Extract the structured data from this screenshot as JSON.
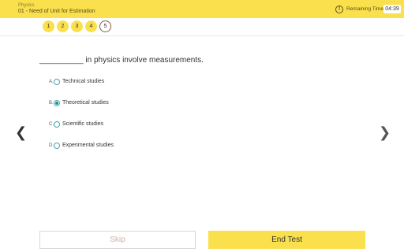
{
  "header": {
    "subject": "Physics",
    "topic": "01 - Need of Unit for Estimation",
    "timer_icon": "info-icon",
    "timer_label": "Remaining Time:",
    "timer_value": "04:39"
  },
  "question_nav": [
    "1",
    "2",
    "3",
    "4",
    "5"
  ],
  "question": {
    "text": "__________ in physics involve measurements.",
    "options": [
      {
        "letter": "A.",
        "text": "Technical studies"
      },
      {
        "letter": "B.",
        "text": "Theoretical studies"
      },
      {
        "letter": "C.",
        "text": "Scientific studies"
      },
      {
        "letter": "D.",
        "text": "Experimental studies"
      }
    ],
    "selected": "B."
  },
  "nav": {
    "prev_icon": "chevron-left-icon",
    "next_icon": "chevron-right-icon"
  },
  "buttons": {
    "skip": "Skip",
    "end": "End Test"
  },
  "colors": {
    "accent": "#f9e04c",
    "radio": "#1f8f8f"
  }
}
